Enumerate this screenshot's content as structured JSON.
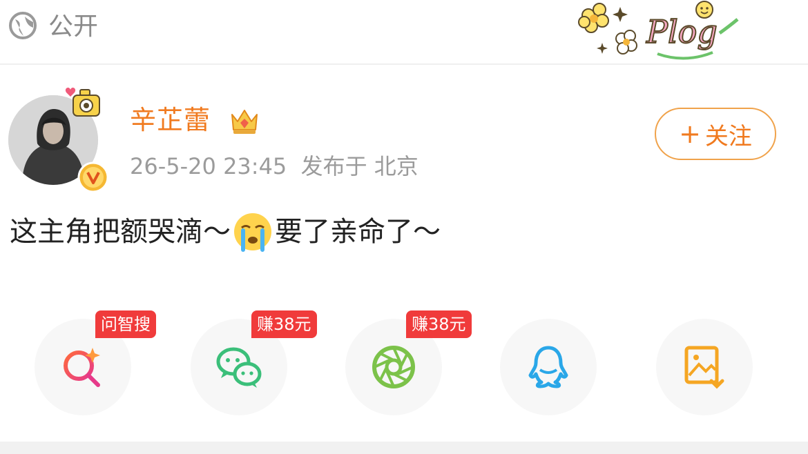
{
  "header": {
    "visibility_icon": "globe-icon",
    "visibility_label": "公开",
    "sticker_text": "Plog"
  },
  "post": {
    "author_name": "辛芷蕾",
    "timestamp": "26-5-20 23:45",
    "location": "发布于 北京",
    "follow_label": "关注",
    "text_before_emoji": "这主角把额哭滴～",
    "emoji": "crying-face-emoji",
    "text_after_emoji": "要了亲命了～"
  },
  "share": {
    "items": [
      {
        "icon": "search-sparkle-icon",
        "badge": "问智搜"
      },
      {
        "icon": "wechat-icon",
        "badge": "赚38元"
      },
      {
        "icon": "wechat-moments-icon",
        "badge": "赚38元"
      },
      {
        "icon": "qq-icon",
        "badge": ""
      },
      {
        "icon": "save-image-icon",
        "badge": ""
      }
    ]
  },
  "colors": {
    "accent_orange": "#f07a1f",
    "badge_red": "#f03b3b",
    "wechat_green": "#3bbf7a",
    "moments_green": "#7cc24a",
    "qq_blue": "#2aa7e8",
    "save_orange": "#f5a623"
  }
}
